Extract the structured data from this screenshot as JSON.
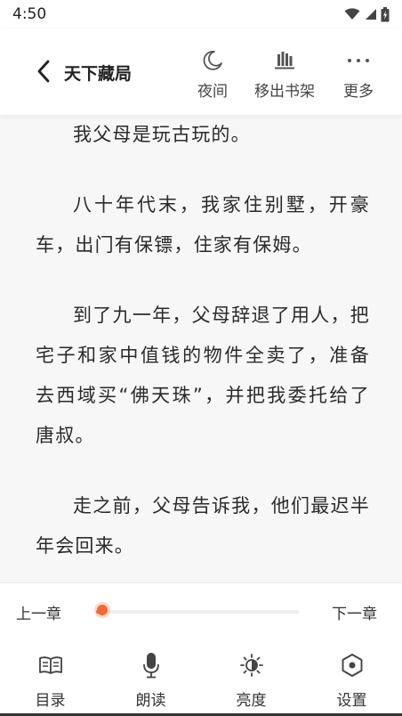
{
  "status_bar": {
    "time": "4:50"
  },
  "header": {
    "title": "天下藏局",
    "actions": [
      {
        "label": "夜间",
        "icon": "moon-icon"
      },
      {
        "label": "移出书架",
        "icon": "bookshelf-icon"
      },
      {
        "label": "更多",
        "icon": "more-icon"
      }
    ]
  },
  "content": {
    "paragraphs": [
      "我父母是玩古玩的。",
      "八十年代末，我家住别墅，开豪车，出门有保镖，住家有保姆。",
      "到了九一年，父母辞退了用人，把宅子和家中值钱的物件全卖了，准备去西域买“佛天珠”，并把我委托给了唐叔。",
      "走之前，父母告诉我，他们最迟半年会回来。"
    ]
  },
  "chapter_nav": {
    "prev": "上一章",
    "next": "下一章",
    "progress": 0.03
  },
  "bottom_bar": {
    "items": [
      {
        "label": "目录",
        "icon": "catalog-icon"
      },
      {
        "label": "朗读",
        "icon": "microphone-icon"
      },
      {
        "label": "亮度",
        "icon": "brightness-icon"
      },
      {
        "label": "设置",
        "icon": "settings-icon"
      }
    ]
  },
  "colors": {
    "accent": "#f06a35",
    "background": "#f7f7f7",
    "text": "#2a2a2a"
  }
}
